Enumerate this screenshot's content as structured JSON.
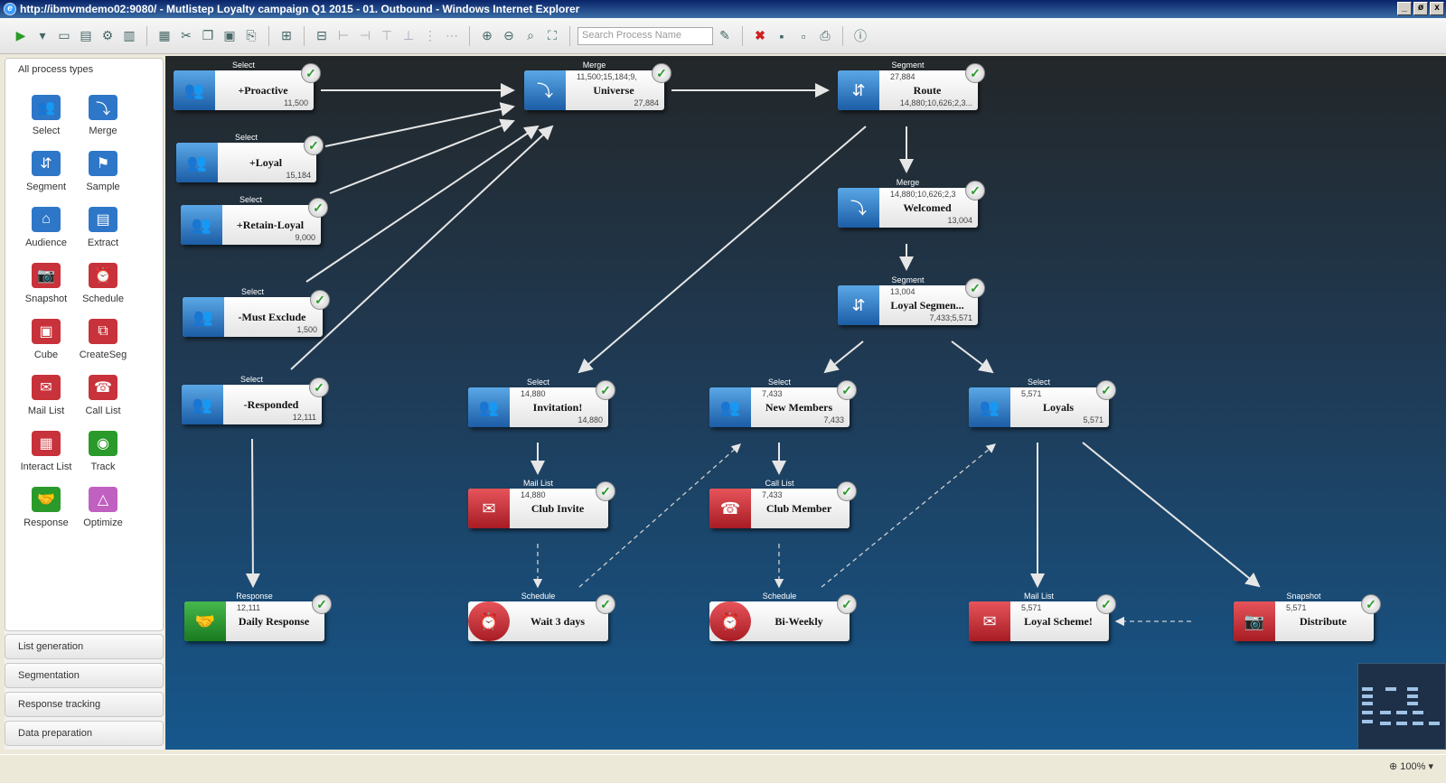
{
  "window": {
    "title": "http://ibmvmdemo02:9080/ - Mutlistep Loyalty campaign Q1 2015 - 01. Outbound - Windows Internet Explorer",
    "controls": [
      "_",
      "ø",
      "x"
    ]
  },
  "toolbar": {
    "search_placeholder": "Search Process Name"
  },
  "palette": {
    "title": "All process types",
    "items": [
      {
        "label": "Select",
        "icon": "select-icon",
        "color": "#2e77c8"
      },
      {
        "label": "Merge",
        "icon": "merge-icon",
        "color": "#2e77c8"
      },
      {
        "label": "Segment",
        "icon": "segment-icon",
        "color": "#2e77c8"
      },
      {
        "label": "Sample",
        "icon": "sample-icon",
        "color": "#2e77c8"
      },
      {
        "label": "Audience",
        "icon": "audience-icon",
        "color": "#2e77c8"
      },
      {
        "label": "Extract",
        "icon": "extract-icon",
        "color": "#2e77c8"
      },
      {
        "label": "Snapshot",
        "icon": "snapshot-icon",
        "color": "#c8323a"
      },
      {
        "label": "Schedule",
        "icon": "schedule-icon",
        "color": "#c8323a"
      },
      {
        "label": "Cube",
        "icon": "cube-icon",
        "color": "#c8323a"
      },
      {
        "label": "CreateSeg",
        "icon": "createseg-icon",
        "color": "#c8323a"
      },
      {
        "label": "Mail List",
        "icon": "mail-list-icon",
        "color": "#c8323a"
      },
      {
        "label": "Call List",
        "icon": "call-list-icon",
        "color": "#c8323a"
      },
      {
        "label": "Interact List",
        "icon": "interact-list-icon",
        "color": "#c8323a"
      },
      {
        "label": "Track",
        "icon": "track-icon",
        "color": "#2a9a2a"
      },
      {
        "label": "Response",
        "icon": "response-icon",
        "color": "#2a9a2a"
      },
      {
        "label": "Optimize",
        "icon": "optimize-icon",
        "color": "#c060c0"
      }
    ],
    "sections": [
      "List generation",
      "Segmentation",
      "Response tracking",
      "Data preparation"
    ]
  },
  "nodes": {
    "proactive": {
      "type": "Select",
      "count": "",
      "label": "+Proactive",
      "sub": "11,500"
    },
    "loyal": {
      "type": "Select",
      "count": "",
      "label": "+Loyal",
      "sub": "15,184"
    },
    "retain_loyal": {
      "type": "Select",
      "count": "",
      "label": "+Retain-Loyal",
      "sub": "9,000"
    },
    "must_exclude": {
      "type": "Select",
      "count": "",
      "label": "-Must Exclude",
      "sub": "1,500"
    },
    "responded": {
      "type": "Select",
      "count": "",
      "label": "-Responded",
      "sub": "12,111"
    },
    "universe": {
      "type": "Merge",
      "count": "11,500;15,184;9,",
      "label": "Universe",
      "sub": "27,884"
    },
    "route": {
      "type": "Segment",
      "count": "27,884",
      "label": "Route",
      "sub": "14,880;10,626;2,3..."
    },
    "welcomed": {
      "type": "Merge",
      "count": "14,880;10,626;2,3",
      "label": "Welcomed",
      "sub": "13,004"
    },
    "loyal_segment": {
      "type": "Segment",
      "count": "13,004",
      "label": "Loyal Segmen...",
      "sub": "7,433;5,571"
    },
    "invitation": {
      "type": "Select",
      "count": "14,880",
      "label": "Invitation!",
      "sub": "14,880"
    },
    "new_members": {
      "type": "Select",
      "count": "7,433",
      "label": "New Members",
      "sub": "7,433"
    },
    "loyals": {
      "type": "Select",
      "count": "5,571",
      "label": "Loyals",
      "sub": "5,571"
    },
    "club_invite": {
      "type": "Mail List",
      "count": "14,880",
      "label": "Club Invite",
      "sub": ""
    },
    "club_member": {
      "type": "Call List",
      "count": "7,433",
      "label": "Club Member",
      "sub": ""
    },
    "daily_response": {
      "type": "Response",
      "count": "12,111",
      "label": "Daily Response",
      "sub": ""
    },
    "wait_3_days": {
      "type": "Schedule",
      "count": "",
      "label": "Wait 3 days",
      "sub": ""
    },
    "bi_weekly": {
      "type": "Schedule",
      "count": "",
      "label": "Bi-Weekly",
      "sub": ""
    },
    "loyal_scheme": {
      "type": "Mail List",
      "count": "5,571",
      "label": "Loyal Scheme!",
      "sub": ""
    },
    "distribute": {
      "type": "Snapshot",
      "count": "5,571",
      "label": "Distribute",
      "sub": ""
    }
  },
  "status": {
    "zoom": "100%"
  }
}
